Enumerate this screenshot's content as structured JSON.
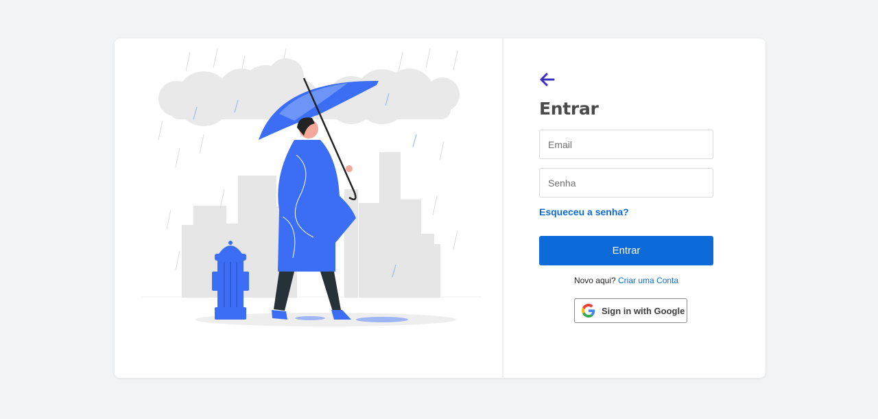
{
  "login": {
    "title": "Entrar",
    "email_placeholder": "Email",
    "password_placeholder": "Senha",
    "forgot_label": "Esqueceu a senha?",
    "submit_label": "Entrar",
    "signup_prompt": "Novo aqui?",
    "signup_link": "Criar uma Conta",
    "google_label": "Sign in with Google"
  },
  "icons": {
    "back": "arrow-left-icon",
    "google": "google-logo-icon"
  },
  "colors": {
    "background": "#f2f3f5",
    "accent": "#0c6bd8",
    "back_arrow": "#3b2fbf",
    "illustration_blue": "#3b6ef5",
    "title_text": "#4a4a4a"
  }
}
